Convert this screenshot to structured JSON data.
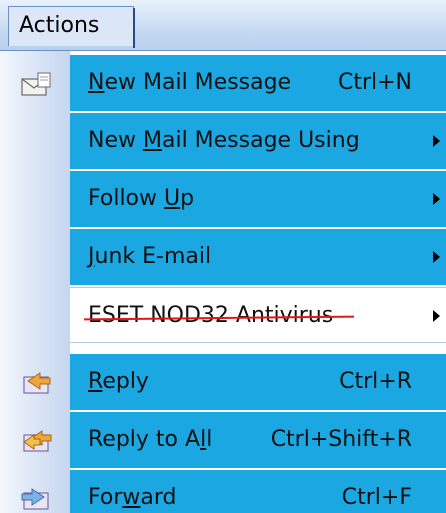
{
  "menubar": {
    "title": "Actions"
  },
  "menu": {
    "items": [
      {
        "label": "New Mail Message",
        "shortcut": "Ctrl+N",
        "icon": "new-mail-icon"
      },
      {
        "label": "New Mail Message Using",
        "shortcut": "",
        "submenu": true
      },
      {
        "label": "Follow Up",
        "shortcut": "",
        "submenu": true
      },
      {
        "label": "Junk E-mail",
        "shortcut": "",
        "submenu": true
      },
      {
        "label": "ESET NOD32 Antivirus",
        "shortcut": "",
        "submenu": true,
        "struck_through": true
      },
      {
        "label": "Reply",
        "shortcut": "Ctrl+R",
        "icon": "reply-icon"
      },
      {
        "label": "Reply to All",
        "shortcut": "Ctrl+Shift+R",
        "icon": "reply-all-icon"
      },
      {
        "label": "Forward",
        "shortcut": "Ctrl+F",
        "icon": "forward-icon"
      }
    ]
  },
  "colors": {
    "highlight": "#1aa7e2",
    "strike": "#e31515",
    "menubar": "#c7daf3"
  }
}
